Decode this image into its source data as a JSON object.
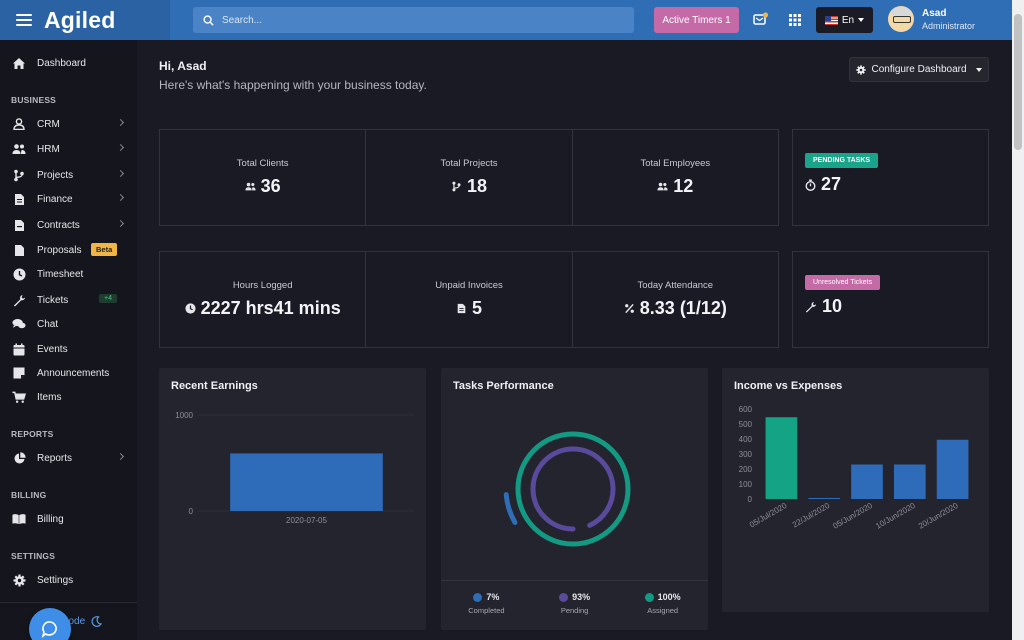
{
  "topbar": {
    "logo": "Agiled",
    "search_placeholder": "Search...",
    "active_timers": "Active Timers 1",
    "language": "En",
    "user_name": "Asad",
    "user_role": "Administrator"
  },
  "sidebar": {
    "dashboard": "Dashboard",
    "business_head": "BUSINESS",
    "crm": "CRM",
    "hrm": "HRM",
    "projects": "Projects",
    "finance": "Finance",
    "contracts": "Contracts",
    "proposals": "Proposals",
    "proposals_badge": "Beta",
    "timesheet": "Timesheet",
    "tickets": "Tickets",
    "tickets_badge": "+4",
    "chat": "Chat",
    "events": "Events",
    "announcements": "Announcements",
    "items": "Items",
    "reports_head": "REPORTS",
    "reports": "Reports",
    "billing_head": "BILLING",
    "billing": "Billing",
    "settings_head": "SETTINGS",
    "settings": "Settings",
    "night_mode": "Night mode"
  },
  "main": {
    "greeting": "Hi, Asad",
    "subtitle": "Here's what's happening with your business today.",
    "configure_label": "Configure Dashboard"
  },
  "stats_row1": [
    {
      "label": "Total Clients",
      "value": "36"
    },
    {
      "label": "Total Projects",
      "value": "18"
    },
    {
      "label": "Total Employees",
      "value": "12"
    }
  ],
  "pending_tasks": {
    "badge": "PENDING TASKS",
    "value": "27"
  },
  "stats_row2": [
    {
      "label": "Hours Logged",
      "value": "2227 hrs41 mins"
    },
    {
      "label": "Unpaid Invoices",
      "value": "5"
    },
    {
      "label": "Today Attendance",
      "value": "8.33 (1/12)"
    }
  ],
  "unresolved_tickets": {
    "badge": "Unresolved Tickets",
    "value": "10"
  },
  "panels": {
    "recent_earnings": "Recent Earnings",
    "tasks_performance": "Tasks Performance",
    "income_vs_expenses": "Income vs Expenses"
  },
  "tasks_legend": [
    {
      "pct": "7%",
      "label": "Completed"
    },
    {
      "pct": "93%",
      "label": "Pending"
    },
    {
      "pct": "100%",
      "label": "Assigned"
    }
  ],
  "colors": {
    "brand": "#2f6db5",
    "timers": "#c46aa6",
    "pending_badge": "#1aa58a",
    "unresolved_badge": "#c46aa6",
    "completed": "#2f6db5",
    "pending": "#5a4a9c",
    "assigned": "#139a83",
    "income_bar": "#14a384",
    "expense_bar": "#2e6bb8"
  },
  "chart_data": [
    {
      "type": "bar",
      "title": "Recent Earnings",
      "categories": [
        "2020-07-05"
      ],
      "values": [
        600
      ],
      "y_ticks": [
        "0",
        "1000"
      ],
      "ylim": [
        0,
        1000
      ]
    },
    {
      "type": "pie",
      "title": "Tasks Performance",
      "labels": [
        "Completed",
        "Pending",
        "Assigned"
      ],
      "values": [
        7,
        93,
        100
      ]
    },
    {
      "type": "bar",
      "title": "Income vs Expenses",
      "categories": [
        "05/Jul/2020",
        "22/Jul/2020",
        "05/Jun/2020",
        "10/Jun/2020",
        "20/Jun/2020"
      ],
      "values": [
        545,
        0,
        230,
        230,
        395
      ],
      "y_ticks": [
        "0",
        "100",
        "200",
        "300",
        "400",
        "500",
        "600"
      ],
      "ylim": [
        0,
        600
      ]
    }
  ]
}
